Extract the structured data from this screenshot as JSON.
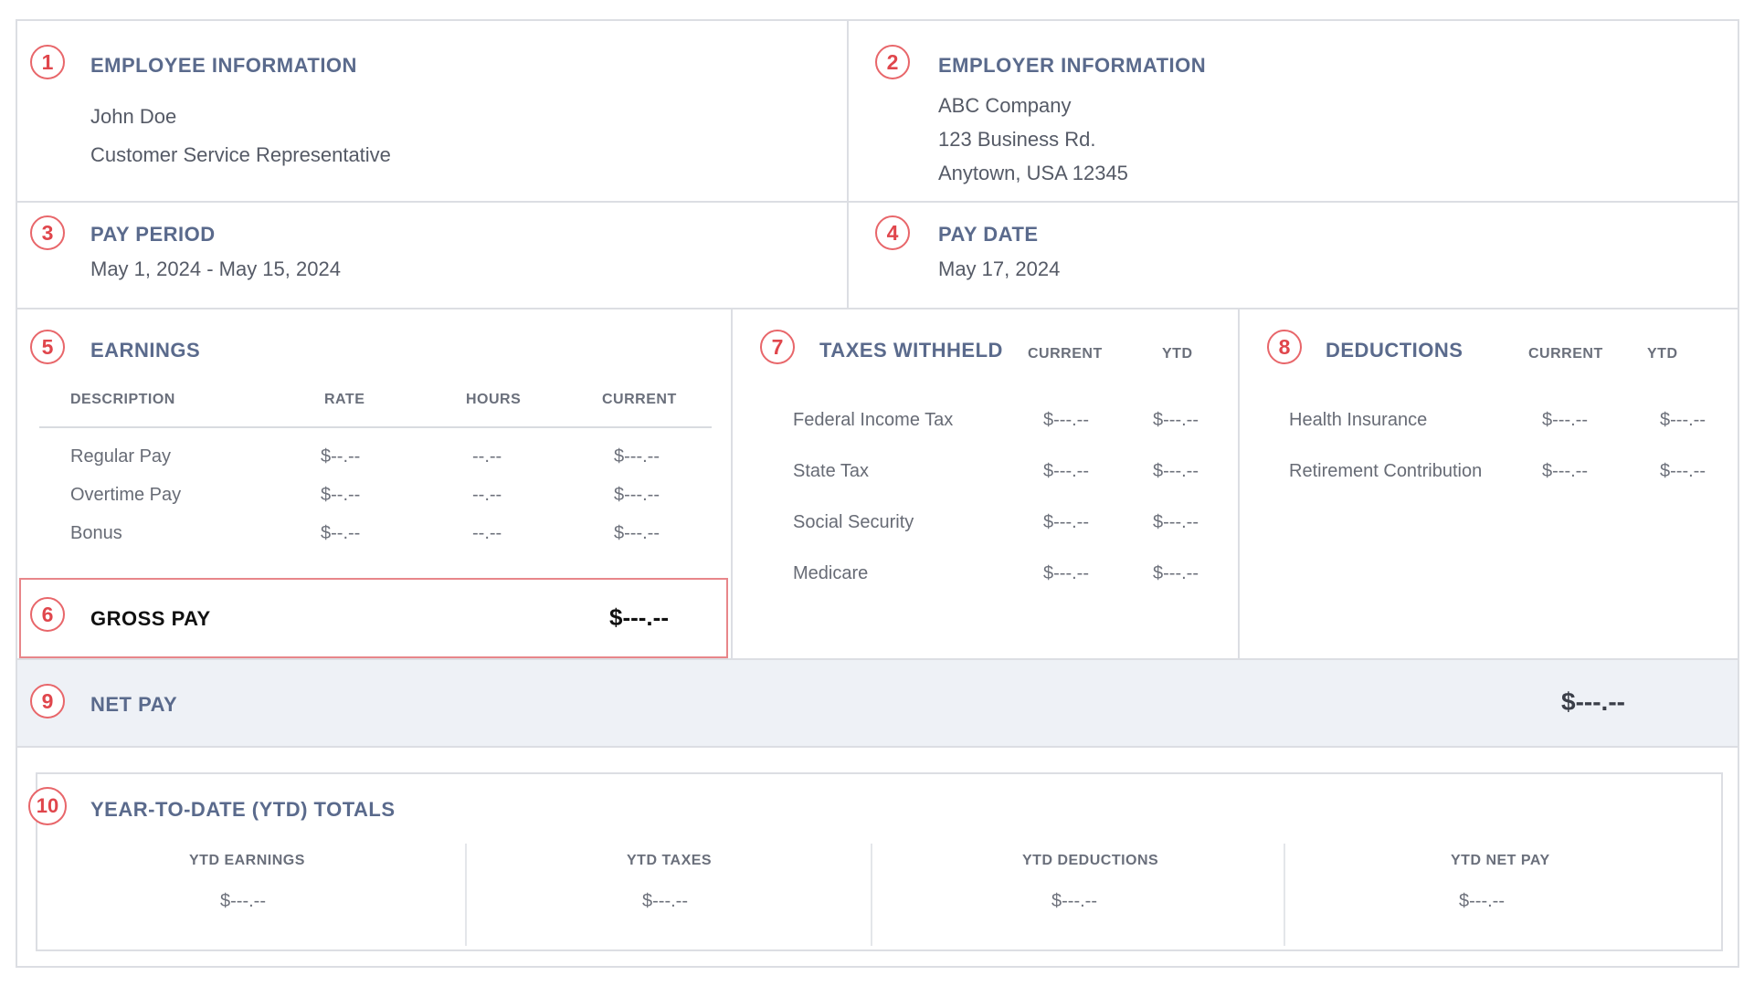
{
  "employee": {
    "num": "1",
    "title": "EMPLOYEE INFORMATION",
    "name": "John Doe",
    "role": "Customer Service Representative"
  },
  "employer": {
    "num": "2",
    "title": "EMPLOYER INFORMATION",
    "company": "ABC Company",
    "address1": "123 Business Rd.",
    "address2": "Anytown, USA 12345"
  },
  "pay_period": {
    "num": "3",
    "title": "PAY PERIOD",
    "value": "May 1, 2024 - May 15, 2024"
  },
  "pay_date": {
    "num": "4",
    "title": "PAY DATE",
    "value": "May 17, 2024"
  },
  "earnings": {
    "num": "5",
    "title": "EARNINGS",
    "headers": [
      "DESCRIPTION",
      "RATE",
      "HOURS",
      "CURRENT"
    ],
    "rows": [
      {
        "desc": "Regular Pay",
        "rate": "$--.--",
        "hours": "--.--",
        "current": "$---.--"
      },
      {
        "desc": "Overtime Pay",
        "rate": "$--.--",
        "hours": "--.--",
        "current": "$---.--"
      },
      {
        "desc": "Bonus",
        "rate": "$--.--",
        "hours": "--.--",
        "current": "$---.--"
      }
    ]
  },
  "gross_pay": {
    "num": "6",
    "label": "GROSS PAY",
    "value": "$---.--"
  },
  "taxes": {
    "num": "7",
    "title": "TAXES WITHHELD",
    "col_current": "CURRENT",
    "col_ytd": "YTD",
    "rows": [
      {
        "desc": "Federal Income Tax",
        "current": "$---.--",
        "ytd": "$---.--"
      },
      {
        "desc": "State Tax",
        "current": "$---.--",
        "ytd": "$---.--"
      },
      {
        "desc": "Social Security",
        "current": "$---.--",
        "ytd": "$---.--"
      },
      {
        "desc": "Medicare",
        "current": "$---.--",
        "ytd": "$---.--"
      }
    ]
  },
  "deductions": {
    "num": "8",
    "title": "DEDUCTIONS",
    "col_current": "CURRENT",
    "col_ytd": "YTD",
    "rows": [
      {
        "desc": "Health Insurance",
        "current": "$---.--",
        "ytd": "$---.--"
      },
      {
        "desc": "Retirement Contribution",
        "current": "$---.--",
        "ytd": "$---.--"
      }
    ]
  },
  "net_pay": {
    "num": "9",
    "label": "NET PAY",
    "value": "$---.--"
  },
  "ytd": {
    "num": "10",
    "title": "YEAR-TO-DATE (YTD) TOTALS",
    "items": [
      {
        "label": "YTD EARNINGS",
        "value": "$---.--"
      },
      {
        "label": "YTD TAXES",
        "value": "$---.--"
      },
      {
        "label": "YTD DEDUCTIONS",
        "value": "$---.--"
      },
      {
        "label": "YTD NET PAY",
        "value": "$---.--"
      }
    ]
  },
  "colors": {
    "accent_red": "#e0464c",
    "title_blue": "#5a6a8c",
    "net_pay_bg": "#eef1f6",
    "border": "#dcdee3"
  }
}
